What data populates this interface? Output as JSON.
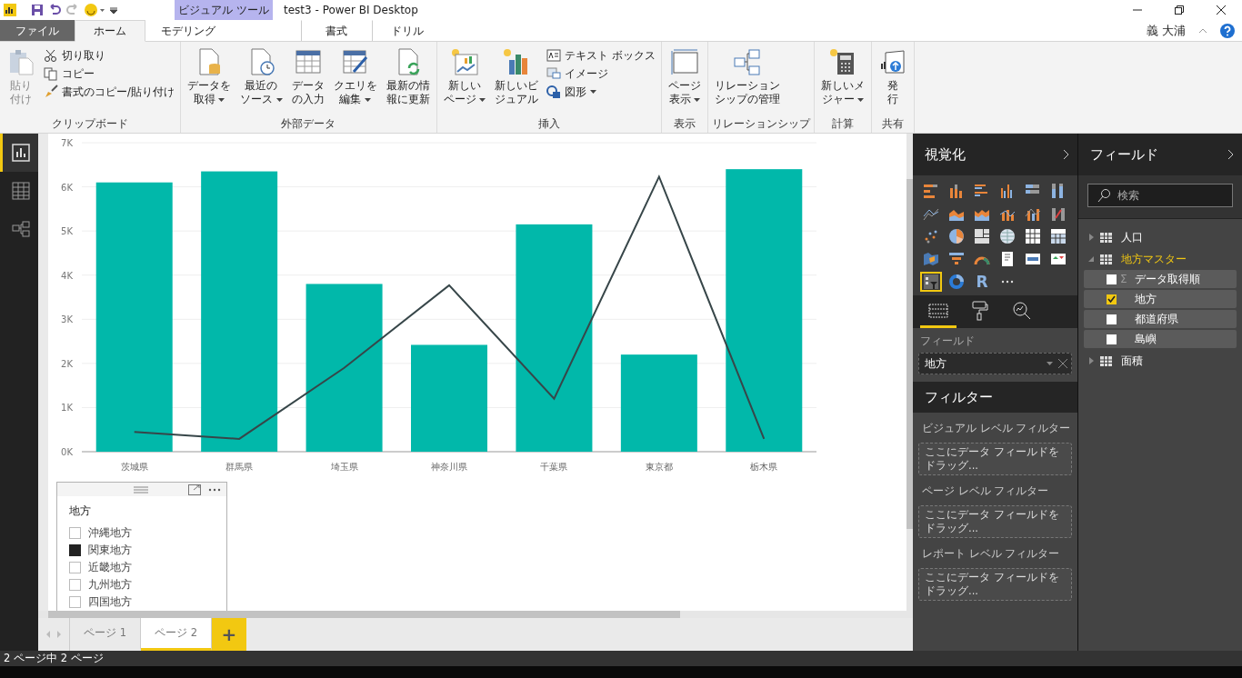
{
  "title_bar": {
    "context_tab": "ビジュアル ツール",
    "title": "test3 - Power BI Desktop",
    "user": "義 大浦"
  },
  "ribbon_tabs": [
    {
      "label": "ファイル",
      "kind": "file",
      "selected": false
    },
    {
      "label": "ホーム",
      "kind": "tab",
      "selected": true
    },
    {
      "label": "モデリング",
      "kind": "tab",
      "selected": false
    },
    {
      "label": "書式",
      "kind": "context",
      "selected": false
    },
    {
      "label": "ドリル",
      "kind": "context",
      "selected": false
    }
  ],
  "ribbon_groups": [
    {
      "label": "クリップボード",
      "buttons": [
        {
          "kind": "big",
          "lines": [
            "貼り",
            "付け"
          ],
          "dropdown": false,
          "disabled": true
        },
        {
          "kind": "small",
          "label": "切り取り",
          "dropdown": false
        },
        {
          "kind": "small",
          "label": "コピー",
          "dropdown": false
        },
        {
          "kind": "small",
          "label": "書式のコピー/貼り付け",
          "dropdown": false
        }
      ]
    },
    {
      "label": "外部データ",
      "buttons": [
        {
          "kind": "big",
          "lines": [
            "データを",
            "取得"
          ],
          "dropdown": true,
          "disabled": false
        },
        {
          "kind": "big",
          "lines": [
            "最近の",
            "ソース"
          ],
          "dropdown": true,
          "disabled": false
        },
        {
          "kind": "big",
          "lines": [
            "データ",
            "の入力"
          ],
          "dropdown": false,
          "disabled": false
        },
        {
          "kind": "big",
          "lines": [
            "クエリを",
            "編集"
          ],
          "dropdown": true,
          "disabled": false
        },
        {
          "kind": "big",
          "lines": [
            "最新の情",
            "報に更新"
          ],
          "dropdown": false,
          "disabled": false
        }
      ]
    },
    {
      "label": "挿入",
      "buttons": [
        {
          "kind": "big",
          "lines": [
            "新しい",
            "ページ"
          ],
          "dropdown": true,
          "disabled": false
        },
        {
          "kind": "big",
          "lines": [
            "新しいビ",
            "ジュアル"
          ],
          "dropdown": false,
          "disabled": false
        },
        {
          "kind": "small",
          "label": "テキスト ボックス",
          "dropdown": false
        },
        {
          "kind": "small",
          "label": "イメージ",
          "dropdown": false
        },
        {
          "kind": "small",
          "label": "図形",
          "dropdown": true
        }
      ]
    },
    {
      "label": "表示",
      "buttons": [
        {
          "kind": "big",
          "lines": [
            "ページ",
            "表示"
          ],
          "dropdown": true,
          "disabled": false
        }
      ]
    },
    {
      "label": "リレーションシップ",
      "buttons": [
        {
          "kind": "big",
          "lines": [
            "リレーション",
            "シップの管理"
          ],
          "dropdown": false,
          "disabled": false
        }
      ]
    },
    {
      "label": "計算",
      "buttons": [
        {
          "kind": "big",
          "lines": [
            "新しいメ",
            "ジャー"
          ],
          "dropdown": true,
          "disabled": false
        }
      ]
    },
    {
      "label": "共有",
      "buttons": [
        {
          "kind": "big",
          "lines": [
            "発",
            "行"
          ],
          "dropdown": false,
          "disabled": false
        }
      ]
    }
  ],
  "left_nav": [
    {
      "selected": true
    },
    {
      "selected": false
    },
    {
      "selected": false
    }
  ],
  "report": {
    "chart_data": {
      "type": "bar",
      "categories": [
        "茨城県",
        "群馬県",
        "埼玉県",
        "神奈川県",
        "千葉県",
        "東京都",
        "栃木県"
      ],
      "series": [
        {
          "type": "bar",
          "color": "#01b8aa",
          "values": [
            6100,
            6350,
            3800,
            2420,
            5150,
            2200,
            6400
          ]
        },
        {
          "type": "line",
          "color": "#374649",
          "values": [
            450,
            290,
            1900,
            3770,
            1200,
            6230,
            290
          ]
        }
      ],
      "ylim": [
        0,
        7000
      ],
      "grid": true,
      "yticks": [
        {
          "value": 0,
          "label": "0K"
        },
        {
          "value": 1000,
          "label": "1K"
        },
        {
          "value": 2000,
          "label": "2K"
        },
        {
          "value": 3000,
          "label": "3K"
        },
        {
          "value": 4000,
          "label": "4K"
        },
        {
          "value": 5000,
          "label": "5K"
        },
        {
          "value": 6000,
          "label": "6K"
        },
        {
          "value": 7000,
          "label": "7K"
        }
      ]
    },
    "slicer": {
      "title": "地方",
      "items": [
        {
          "label": "沖縄地方",
          "checked": false
        },
        {
          "label": "関東地方",
          "checked": true
        },
        {
          "label": "近畿地方",
          "checked": false
        },
        {
          "label": "九州地方",
          "checked": false
        },
        {
          "label": "四国地方",
          "checked": false
        }
      ]
    }
  },
  "page_tabs": [
    {
      "label": "ページ 1",
      "selected": false
    },
    {
      "label": "ページ 2",
      "selected": true
    }
  ],
  "add_page": "+",
  "visualizations": {
    "title": "視覚化",
    "visual_types": [
      {
        "selected": false
      },
      {
        "selected": false
      },
      {
        "selected": false
      },
      {
        "selected": false
      },
      {
        "selected": false
      },
      {
        "selected": false
      },
      {
        "selected": false
      },
      {
        "selected": false
      },
      {
        "selected": false
      },
      {
        "selected": false
      },
      {
        "selected": false
      },
      {
        "selected": false
      },
      {
        "selected": false
      },
      {
        "selected": false
      },
      {
        "selected": false
      },
      {
        "selected": false
      },
      {
        "selected": false
      },
      {
        "selected": false
      },
      {
        "selected": false
      },
      {
        "selected": false
      },
      {
        "selected": false
      },
      {
        "selected": false
      },
      {
        "selected": false
      },
      {
        "selected": false
      },
      {
        "selected": true
      },
      {
        "selected": false
      },
      {
        "selected": false,
        "label": "R"
      },
      {
        "selected": false
      }
    ],
    "pane_tabs": [
      {
        "selected": true
      },
      {
        "selected": false
      },
      {
        "selected": false
      }
    ],
    "fields_label": "フィールド",
    "field_well": "地方",
    "filters_title": "フィルター",
    "filter_sections": [
      {
        "label": "ビジュアル レベル フィルター",
        "drop_hint": "ここにデータ フィールドをドラッグ..."
      },
      {
        "label": "ページ レベル フィルター",
        "drop_hint": "ここにデータ フィールドをドラッグ..."
      },
      {
        "label": "レポート レベル フィルター",
        "drop_hint": "ここにデータ フィールドをドラッグ..."
      }
    ]
  },
  "fields": {
    "title": "フィールド",
    "search_placeholder": "検索",
    "tables": [
      {
        "name": "人口",
        "expanded": false
      },
      {
        "name": "地方マスター",
        "expanded": true,
        "children": [
          {
            "name": "データ取得順",
            "symbol": "Σ",
            "checked": false
          },
          {
            "name": "地方",
            "checked": true
          },
          {
            "name": "都道府県",
            "checked": false
          },
          {
            "name": "島嶼",
            "checked": false
          }
        ]
      },
      {
        "name": "面積",
        "expanded": false
      }
    ]
  },
  "status_bar": "2 ページ中 2 ページ"
}
